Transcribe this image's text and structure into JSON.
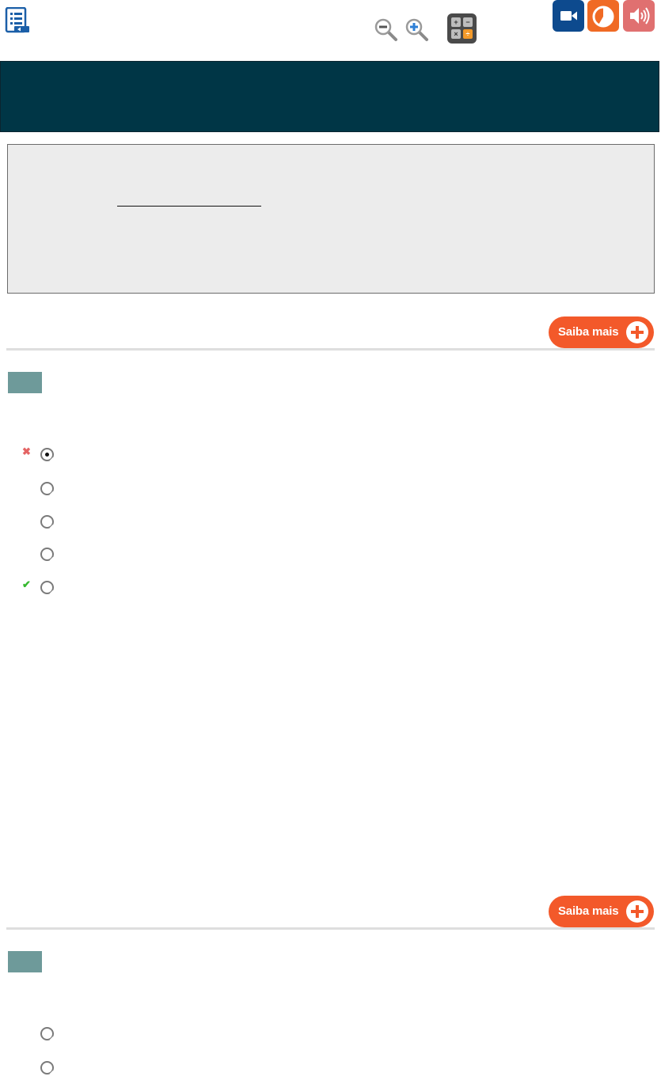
{
  "toolbar": {
    "summary_icon": "list-document-icon",
    "zoom_out_icon": "zoom-out-icon",
    "zoom_in_icon": "zoom-in-icon",
    "calculator_icon": "calculator-icon",
    "calculator_keys": [
      "+",
      "−",
      "×",
      "÷"
    ],
    "video_icon": "video-camera-icon",
    "chart_icon": "pie-chart-icon",
    "audio_icon": "speaker-icon"
  },
  "colors": {
    "banner": "#003646",
    "saiba_mais": "#f3592a",
    "question_number": "#6e9a9a",
    "video_button": "#0d4a8e",
    "chart_button": "#f06a24",
    "audio_button": "#e07070"
  },
  "questions": [
    {
      "saiba_mais_label": "Saiba mais",
      "options": [
        {
          "selected": true,
          "feedback": "wrong",
          "feedback_icon": "x-icon"
        },
        {
          "selected": false,
          "feedback": "",
          "feedback_icon": ""
        },
        {
          "selected": false,
          "feedback": "",
          "feedback_icon": ""
        },
        {
          "selected": false,
          "feedback": "",
          "feedback_icon": ""
        },
        {
          "selected": false,
          "feedback": "correct",
          "feedback_icon": "check-icon"
        }
      ]
    },
    {
      "saiba_mais_label": "Saiba mais",
      "options": [
        {
          "selected": false
        },
        {
          "selected": false
        }
      ]
    }
  ]
}
